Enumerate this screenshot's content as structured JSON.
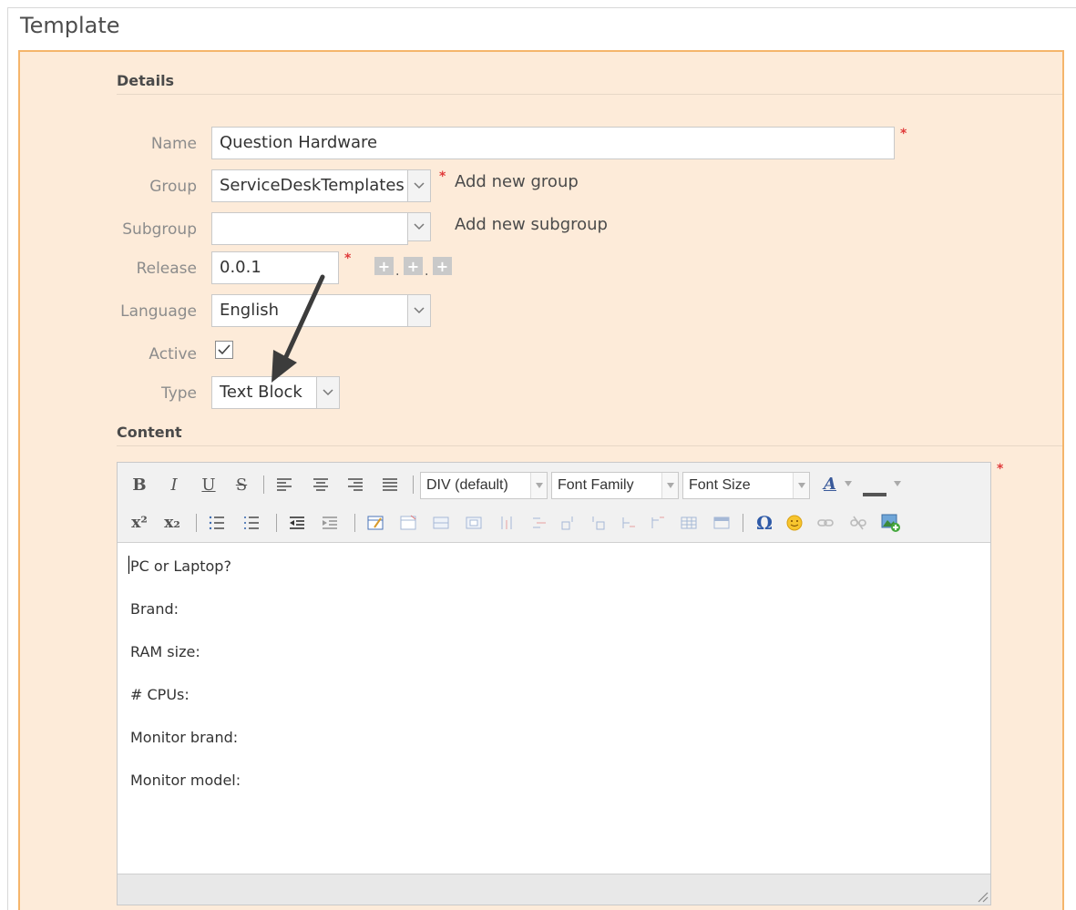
{
  "page": {
    "title": "Template"
  },
  "details": {
    "section_title": "Details",
    "name": {
      "label": "Name",
      "value": "Question Hardware"
    },
    "group": {
      "label": "Group",
      "value": "ServiceDeskTemplates",
      "add_link": "Add new group"
    },
    "subgroup": {
      "label": "Subgroup",
      "value": "",
      "add_link": "Add new subgroup"
    },
    "release": {
      "label": "Release",
      "value": "0.0.1",
      "increment_buttons": [
        "+",
        "+",
        "+"
      ]
    },
    "language": {
      "label": "Language",
      "value": "English"
    },
    "active": {
      "label": "Active",
      "checked": true
    },
    "type": {
      "label": "Type",
      "value": "Text Block"
    },
    "required_marker": "*"
  },
  "content": {
    "section_title": "Content",
    "toolbar": {
      "format_select": "DIV (default)",
      "font_family_select": "Font Family",
      "font_size_select": "Font Size"
    },
    "lines": [
      "PC or Laptop?",
      "Brand:",
      "RAM size:",
      "# CPUs:",
      "Monitor brand:",
      "Monitor model:"
    ]
  },
  "colors": {
    "panel_bg": "#fdebd9",
    "panel_border": "#f5b56b",
    "required": "#e03a3a",
    "arrow": "#3c3c3c"
  }
}
